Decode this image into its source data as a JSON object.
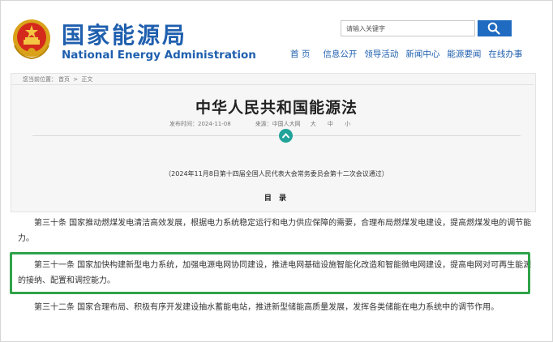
{
  "header": {
    "site_name_cn": "国家能源局",
    "site_name_en": "National Energy Administration",
    "search_placeholder": "请输入关键字",
    "nav": [
      "首 页",
      "信息公开",
      "领导活动",
      "新闻中心",
      "能源要闻",
      "在线办事"
    ]
  },
  "breadcrumb": {
    "prefix": "您当前位置：",
    "home": "首页",
    "sep": " > ",
    "current": "正文"
  },
  "article": {
    "title": "中华人民共和国能源法",
    "publish_label": "发布时间：",
    "publish_date": "2024-11-08",
    "source_label": "来源：",
    "source": "中国人大网",
    "font_sizes": "大 中 小",
    "adoption_note": "（2024年11月8日第十四届全国人民代表大会常务委员会第十二次会议通过）",
    "toc_label": "目 录",
    "paragraphs": [
      "第三十条 国家推动燃煤发电清洁高效发展，根据电力系统稳定运行和电力供应保障的需要，合理布局燃煤发电建设，提高燃煤发电的调节能力。",
      "第三十一条 国家加快构建新型电力系统，加强电源电网协同建设，推进电网基础设施智能化改造和智能微电网建设，提高电网对可再生能源的接纳、配置和调控能力。",
      "第三十二条 国家合理布局、积极有序开发建设抽水蓄能电站，推进新型储能高质量发展，发挥各类储能在电力系统中的调节作用。"
    ]
  },
  "colors": {
    "brand_blue": "#1f5fae",
    "highlight_green": "#2fa34a",
    "toggle_teal": "#22a39a"
  }
}
